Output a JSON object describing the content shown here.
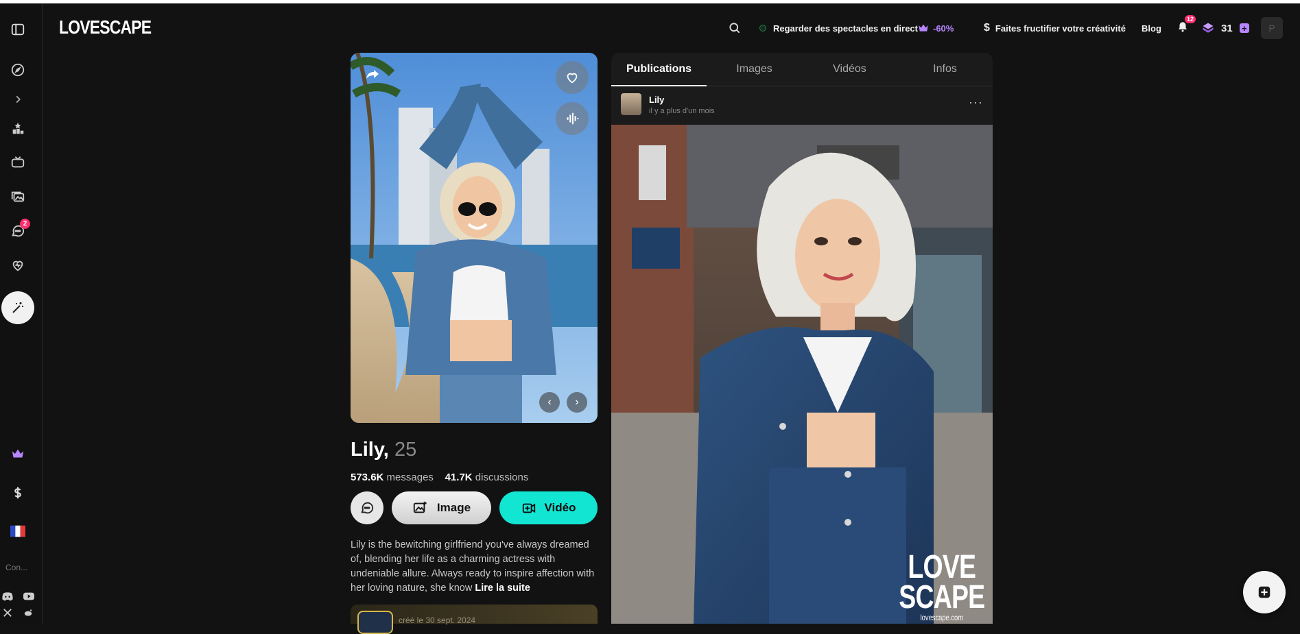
{
  "app": {
    "logo": "LOVESCAPE"
  },
  "sidebar": {
    "chat_badge": "2",
    "lang_label": "Con..."
  },
  "header": {
    "live_label": "Regarder des spectacles en direct",
    "promo_label": "-60%",
    "monetize_label": "Faites fructifier votre créativité",
    "blog_label": "Blog",
    "notif_count": "12",
    "gems_count": "31",
    "avatar_letter": "P"
  },
  "profile": {
    "name": "Lily,",
    "age": "25",
    "messages_count": "573.6K",
    "messages_label": "messages",
    "discussions_count": "41.7K",
    "discussions_label": "discussions",
    "image_button": "Image",
    "video_button": "Vidéo",
    "description": "Lily is the bewitching girlfriend you've always dreamed of, blending her life as a charming actress with undeniable allure. Always ready to inspire affection with her loving nature, she know",
    "read_more": "Lire la suite",
    "created": "créé le 30 sept. 2024"
  },
  "panel": {
    "tabs": [
      {
        "label": "Publications",
        "active": true
      },
      {
        "label": "Images",
        "active": false
      },
      {
        "label": "Vidéos",
        "active": false
      },
      {
        "label": "Infos",
        "active": false
      }
    ],
    "post": {
      "author": "Lily",
      "time": "il y a plus d'un mois",
      "more": "···",
      "watermark_line1": "LOVE",
      "watermark_line2": "SCAPE",
      "watermark_url": "lovescape.com"
    }
  },
  "colors": {
    "background": "#121212",
    "accent_cyan": "#12e6d3",
    "accent_purple": "#b685ff",
    "badge_pink": "#ff2d6e"
  }
}
